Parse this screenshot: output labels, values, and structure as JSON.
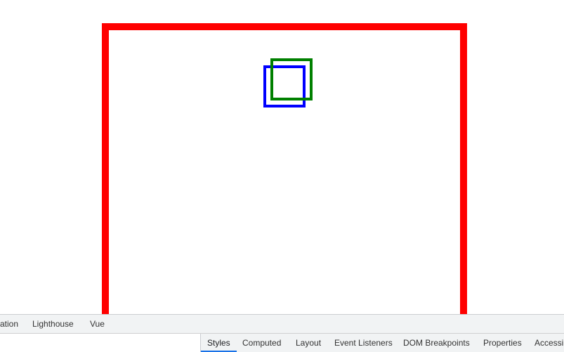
{
  "colors": {
    "outer_box_border": "#ff0000",
    "blue_box_border": "#0000ff",
    "green_box_border": "#008000",
    "active_tab_indicator": "#1a73e8",
    "devtools_bg": "#f1f3f4"
  },
  "devtools": {
    "tabs": [
      {
        "label": "ation"
      },
      {
        "label": "Lighthouse"
      },
      {
        "label": "Vue"
      }
    ]
  },
  "elements_panel": {
    "sidebar_tabs": [
      {
        "label": "Styles",
        "active": true
      },
      {
        "label": "Computed"
      },
      {
        "label": "Layout"
      },
      {
        "label": "Event Listeners"
      },
      {
        "label": "DOM Breakpoints"
      },
      {
        "label": "Properties"
      },
      {
        "label": "Accessib"
      }
    ]
  }
}
